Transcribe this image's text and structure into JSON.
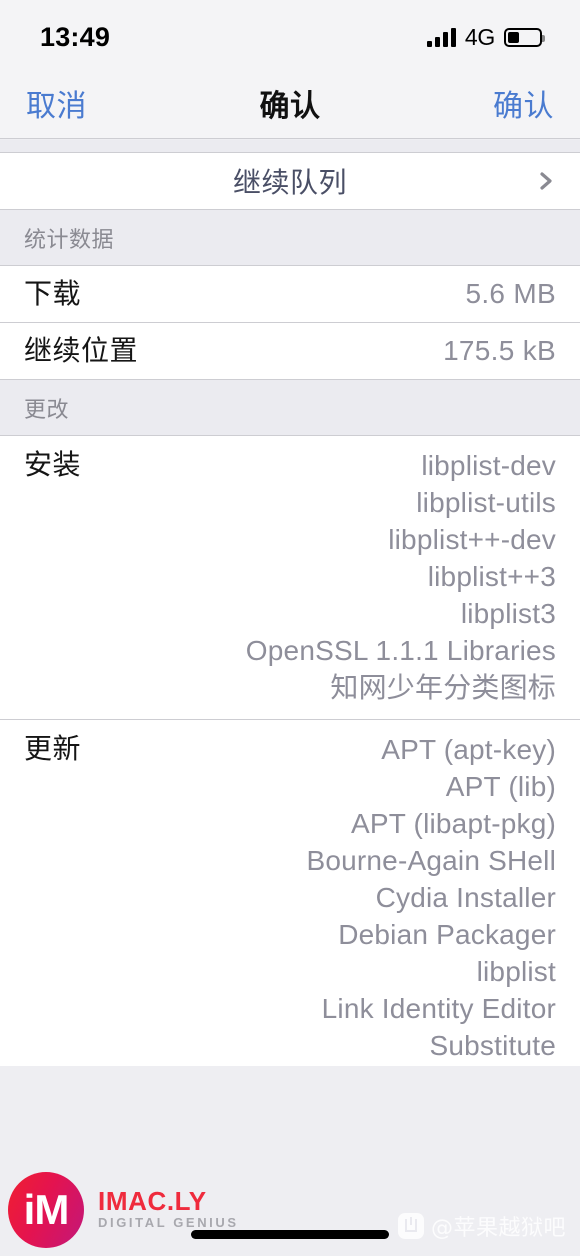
{
  "status_bar": {
    "time": "13:49",
    "carrier_label": "4G",
    "signal_bars": 4,
    "battery_percent": 35
  },
  "nav_bar": {
    "left_button": "取消",
    "title": "确认",
    "right_button": "确认"
  },
  "queue_row": {
    "label": "继续队列",
    "accessory": "chevron-right-icon"
  },
  "sections": [
    {
      "header": "统计数据",
      "rows": [
        {
          "key": "下载",
          "value": "5.6 MB"
        },
        {
          "key": "继续位置",
          "value": "175.5 kB"
        }
      ]
    },
    {
      "header": "更改",
      "rows": [
        {
          "key": "安装",
          "values": [
            "libplist-dev",
            "libplist-utils",
            "libplist++-dev",
            "libplist++3",
            "libplist3",
            "OpenSSL 1.1.1 Libraries",
            "知网少年分类图标"
          ]
        },
        {
          "key": "更新",
          "values": [
            "APT (apt-key)",
            "APT (lib)",
            "APT (libapt-pkg)",
            "Bourne-Again SHell",
            "Cydia Installer",
            "Debian Packager",
            "libplist",
            "Link Identity Editor",
            "Substitute"
          ]
        }
      ]
    }
  ],
  "watermarks": {
    "imacly": {
      "monogram": "iM",
      "name": "IMAC.LY",
      "tagline": "DIGITAL GENIUS"
    },
    "tieba": {
      "handle": "@苹果越狱吧"
    }
  },
  "colors": {
    "accent_blue": "#4a7bd0",
    "group_background": "#eeeef2",
    "section_header_bg": "#ebebf0",
    "value_text": "#8e8e9a",
    "separator": "#cdcdd2",
    "brand_red": "#ef2b3d"
  }
}
